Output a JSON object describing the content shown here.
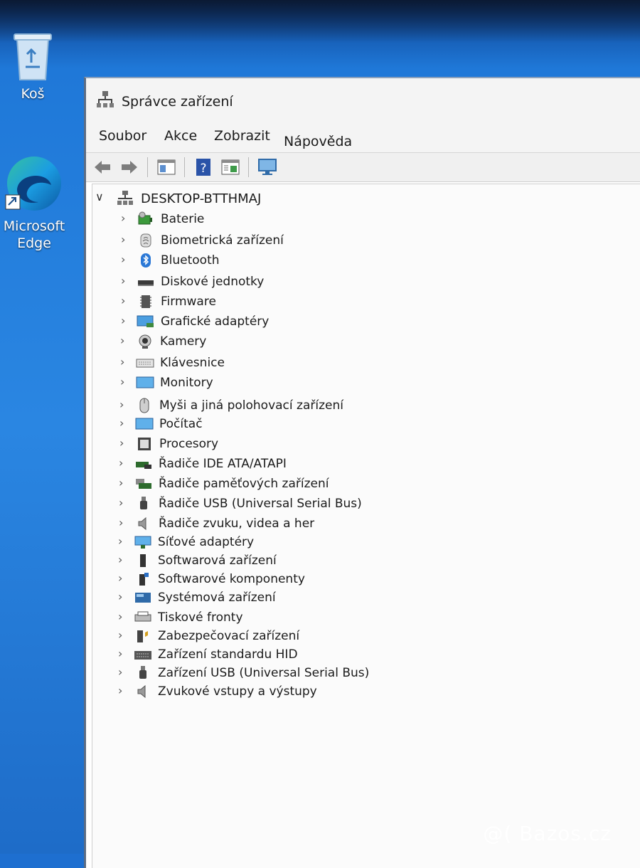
{
  "desktop": {
    "icons": [
      {
        "label": "Koš",
        "icon": "recycle-bin-icon"
      },
      {
        "label": "Microsoft\nEdge",
        "icon": "edge-icon"
      }
    ]
  },
  "window": {
    "title": "Správce zařízení",
    "menu": [
      "Soubor",
      "Akce",
      "Zobrazit",
      "Nápověda"
    ],
    "toolbar": [
      "back-icon",
      "forward-icon",
      "properties-pane-icon",
      "help-icon",
      "view-icon",
      "monitor-scan-icon"
    ],
    "tree": {
      "root": "DESKTOP-BTTHMAJ",
      "categories": [
        {
          "label": "Baterie",
          "icon": "battery-icon"
        },
        {
          "label": "Biometrická zařízení",
          "icon": "fingerprint-icon"
        },
        {
          "label": "Bluetooth",
          "icon": "bluetooth-icon"
        },
        {
          "label": "Diskové jednotky",
          "icon": "disk-drive-icon"
        },
        {
          "label": "Firmware",
          "icon": "firmware-icon"
        },
        {
          "label": "Grafické adaptéry",
          "icon": "display-adapter-icon"
        },
        {
          "label": "Kamery",
          "icon": "camera-icon"
        },
        {
          "label": "Klávesnice",
          "icon": "keyboard-icon"
        },
        {
          "label": "Monitory",
          "icon": "monitor-icon"
        },
        {
          "label": "Myši a jiná polohovací zařízení",
          "icon": "mouse-icon"
        },
        {
          "label": "Počítač",
          "icon": "computer-icon"
        },
        {
          "label": "Procesory",
          "icon": "processor-icon"
        },
        {
          "label": "Řadiče IDE ATA/ATAPI",
          "icon": "ide-controller-icon"
        },
        {
          "label": "Řadiče paměťových zařízení",
          "icon": "storage-controller-icon"
        },
        {
          "label": "Řadiče USB (Universal Serial Bus)",
          "icon": "usb-icon"
        },
        {
          "label": "Řadiče zvuku, videa a her",
          "icon": "speaker-icon"
        },
        {
          "label": "Síťové adaptéry",
          "icon": "network-adapter-icon"
        },
        {
          "label": "Softwarová zařízení",
          "icon": "software-device-icon"
        },
        {
          "label": "Softwarové komponenty",
          "icon": "software-component-icon"
        },
        {
          "label": "Systémová zařízení",
          "icon": "system-device-icon"
        },
        {
          "label": "Tiskové fronty",
          "icon": "printer-icon"
        },
        {
          "label": "Zabezpečovací zařízení",
          "icon": "security-device-icon"
        },
        {
          "label": "Zařízení standardu HID",
          "icon": "hid-icon"
        },
        {
          "label": "Zařízení USB (Universal Serial Bus)",
          "icon": "usb-icon"
        },
        {
          "label": "Zvukové vstupy a výstupy",
          "icon": "speaker-icon"
        }
      ]
    }
  },
  "watermark": "@( Bazos.cz"
}
